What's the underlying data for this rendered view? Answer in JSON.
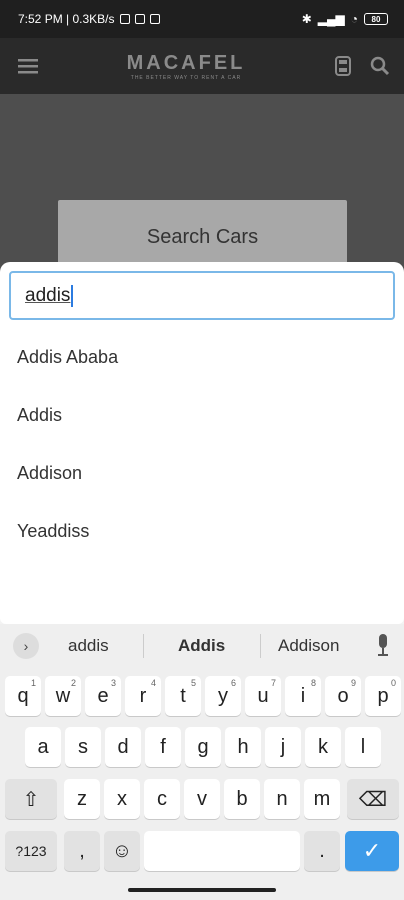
{
  "status_bar": {
    "time_speed": "7:52 PM | 0.3KB/s",
    "battery": "80"
  },
  "app_bar": {
    "logo_word": "MACAFEL",
    "logo_tag": "THE BETTER WAY TO RENT A CAR"
  },
  "background": {
    "search_cars_label": "Search Cars"
  },
  "search": {
    "value": "addis"
  },
  "suggestions": [
    "Addis Ababa",
    "Addis",
    "Addison",
    "Yeaddiss"
  ],
  "keyboard": {
    "toolbar_words": [
      "addis",
      "Addis",
      "Addison"
    ],
    "row1": [
      "q",
      "w",
      "e",
      "r",
      "t",
      "y",
      "u",
      "i",
      "o",
      "p"
    ],
    "row1_hints": [
      "1",
      "2",
      "3",
      "4",
      "5",
      "6",
      "7",
      "8",
      "9",
      "0"
    ],
    "row2": [
      "a",
      "s",
      "d",
      "f",
      "g",
      "h",
      "j",
      "k",
      "l"
    ],
    "row3": [
      "z",
      "x",
      "c",
      "v",
      "b",
      "n",
      "m"
    ],
    "symbols_label": "?123",
    "comma": ",",
    "period": ".",
    "enter_glyph": "✓",
    "shift_glyph": "⇧",
    "backspace_glyph": "⌫",
    "emoji_glyph": "☺"
  }
}
